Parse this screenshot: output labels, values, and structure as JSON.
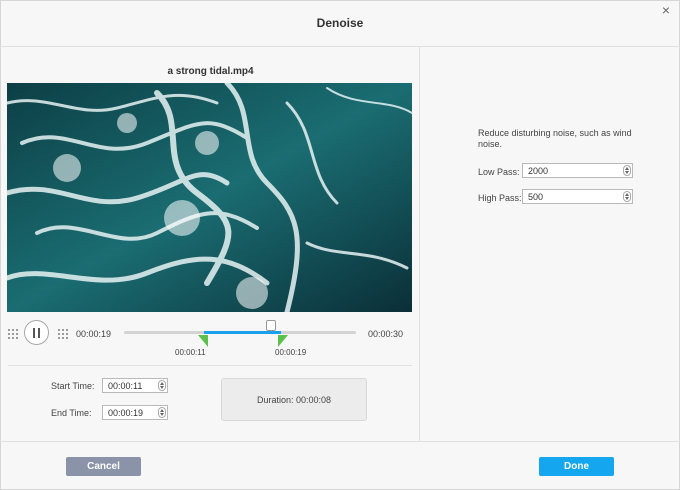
{
  "dialog": {
    "title": "Denoise",
    "close_label": "×"
  },
  "preview": {
    "file_name": "a strong tidal.mp4"
  },
  "player": {
    "current_time": "00:00:19",
    "total_time": "00:00:30",
    "selection_start_label": "00:00:11",
    "selection_end_label": "00:00:19",
    "playhead_fraction": 0.63,
    "selection_start_fraction": 0.367,
    "selection_end_fraction": 0.633
  },
  "trim": {
    "start_label": "Start Time:",
    "start_value": "00:00:11",
    "end_label": "End Time:",
    "end_value": "00:00:19",
    "duration_label": "Duration:",
    "duration_value": "00:00:08"
  },
  "settings": {
    "description": "Reduce disturbing noise, such as wind noise.",
    "low_pass_label": "Low Pass:",
    "low_pass_value": "2000",
    "high_pass_label": "High Pass:",
    "high_pass_value": "500"
  },
  "footer": {
    "cancel_label": "Cancel",
    "done_label": "Done"
  },
  "colors": {
    "selection": "#1aa0ee",
    "handles": "#5bc14a",
    "done": "#14a7ef",
    "cancel": "#8a93a8"
  }
}
